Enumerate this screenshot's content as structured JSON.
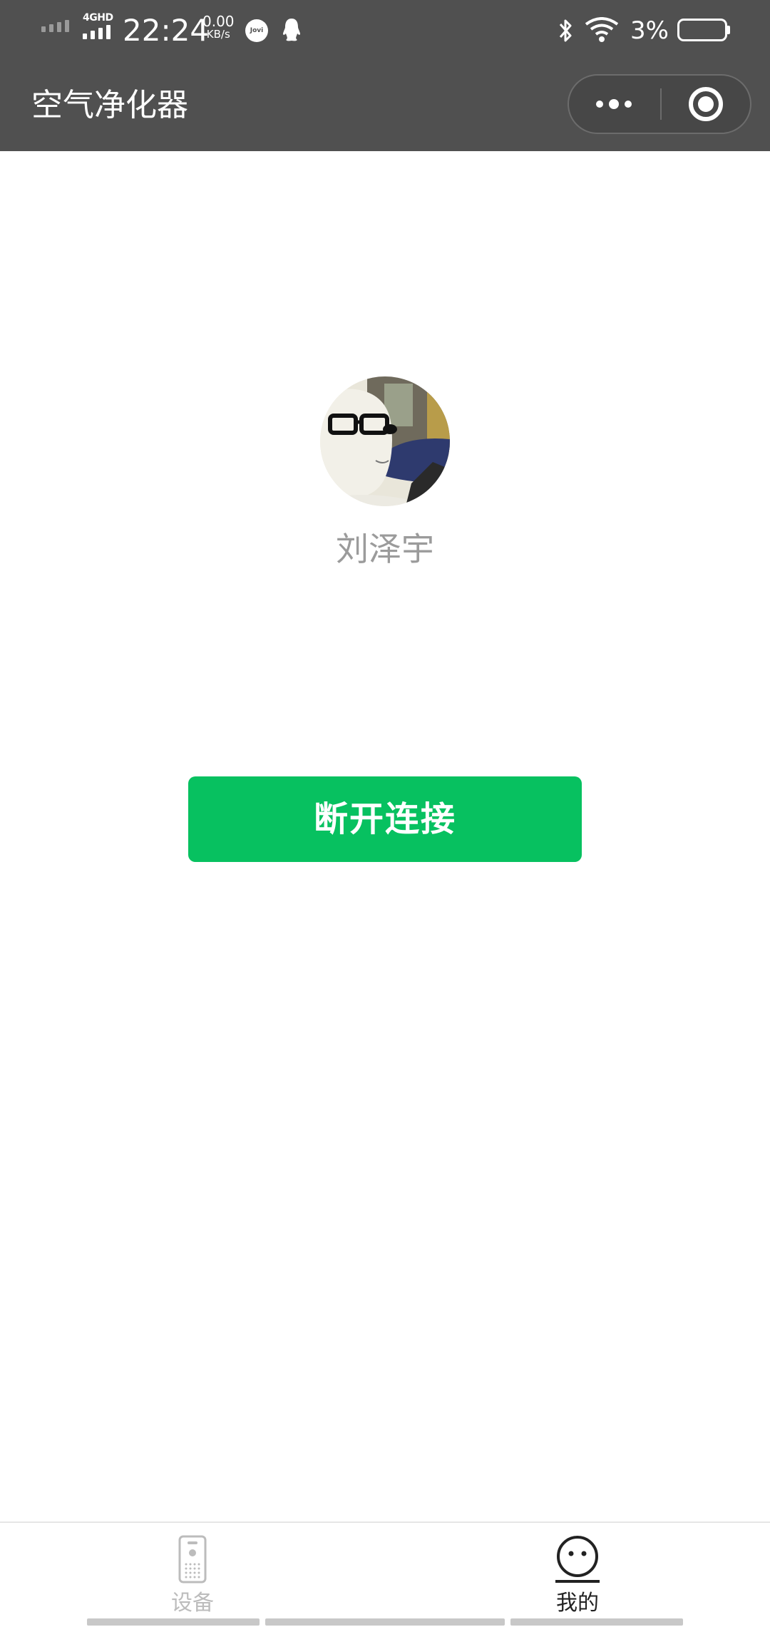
{
  "status_bar": {
    "network": "4GHD",
    "time": "22:24",
    "speed_value": "0.00",
    "speed_unit": "KB/s",
    "jovi": "Jovi",
    "battery": "3%"
  },
  "header": {
    "title": "空气净化器"
  },
  "profile": {
    "name": "刘泽宇"
  },
  "main": {
    "disconnect_label": "断开连接"
  },
  "tabbar": {
    "tabs": [
      {
        "label": "设备",
        "icon": "device-icon",
        "active": false
      },
      {
        "label": "我的",
        "icon": "face-icon",
        "active": true
      }
    ]
  },
  "colors": {
    "nav_bg": "#505050",
    "primary": "#07c160",
    "tab_active": "#222222",
    "tab_inactive": "#bcbcbc"
  }
}
